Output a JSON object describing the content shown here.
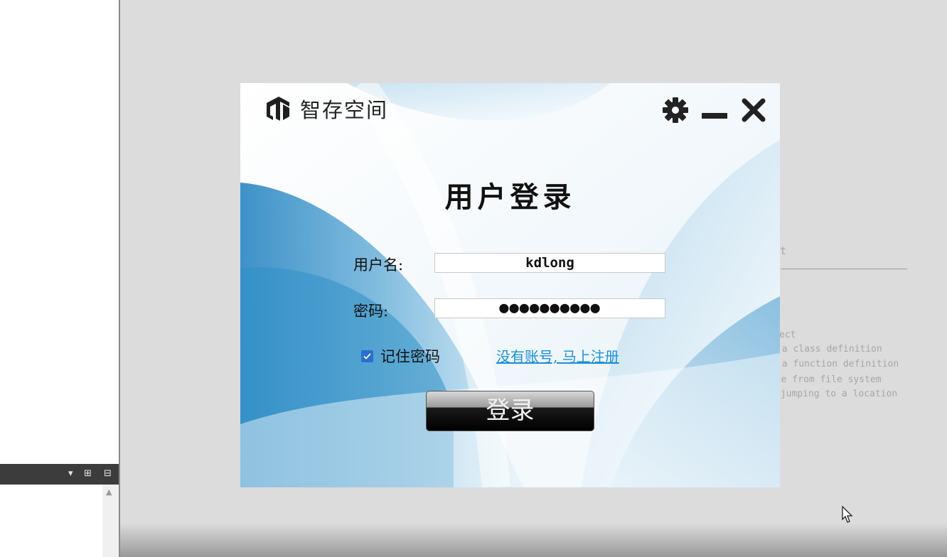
{
  "dialog": {
    "app_name": "智存空间",
    "title": "用户登录",
    "username_label": "用户名:",
    "username_value": "kdlong",
    "password_label": "密码:",
    "password_value": "●●●●●●●●●●",
    "remember_label": "记住密码",
    "remember_checked": true,
    "register_link": "没有账号, 马上注册",
    "login_button": "登录",
    "icons": [
      "logo-icon",
      "gear-icon",
      "minimize-icon",
      "close-icon"
    ],
    "colors": {
      "link": "#1b8fd6",
      "checkbox": "#2a6fd1",
      "accent_blue": "#2f8fc6"
    }
  },
  "background": {
    "partial_heading": "t",
    "partial_lines": [
      "ect",
      " a class definition",
      " a function definition",
      "ile from file system",
      " jumping to a location"
    ]
  }
}
